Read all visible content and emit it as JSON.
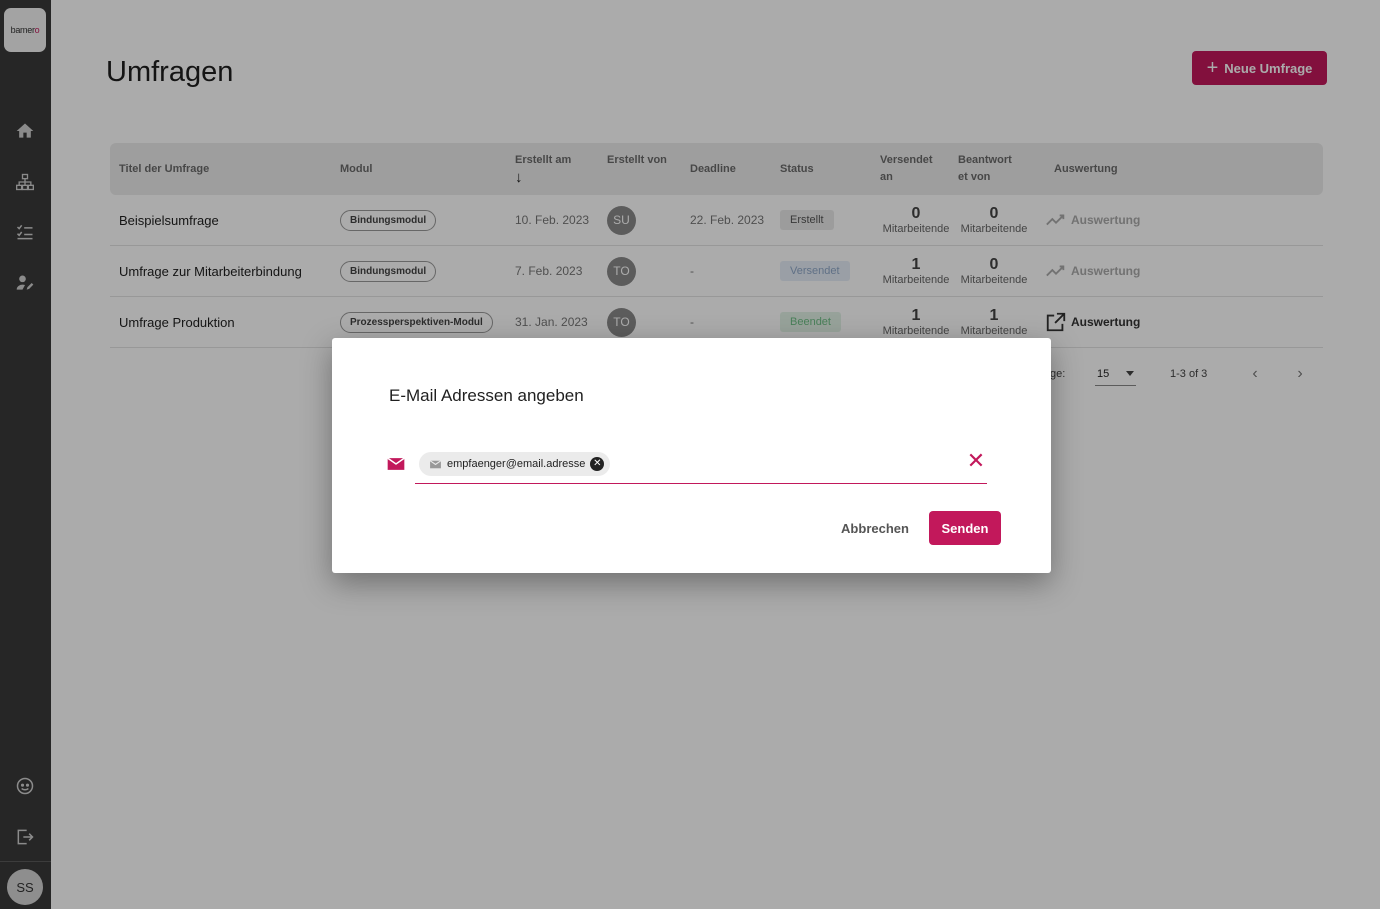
{
  "app": {
    "logo_text": "bamer",
    "logo_accent": "o",
    "user_initials": "SS"
  },
  "sidebar": {
    "icons": [
      "home-icon",
      "org-chart-icon",
      "checklist-icon",
      "user-edit-icon",
      "support-icon",
      "logout-icon"
    ]
  },
  "page": {
    "title": "Umfragen",
    "new_button": "Neue Umfrage",
    "new_button_icon": "+"
  },
  "table": {
    "headers": {
      "title": "Titel der Umfrage",
      "module": "Modul",
      "created_at": "Erstellt am",
      "created_by": "Erstellt von",
      "deadline": "Deadline",
      "status": "Status",
      "sent_to_1": "Versendet",
      "sent_to_2": "an",
      "answered_1": "Beantwort",
      "answered_2": "et von",
      "evaluation": "Auswertung"
    },
    "rows": [
      {
        "title": "Beispielsumfrage",
        "module": "Bindungsmodul",
        "created_at": "10. Feb. 2023",
        "created_by": "SU",
        "deadline": "22. Feb. 2023",
        "status": "Erstellt",
        "sent": "0",
        "sent_unit": "Mitarbeitende",
        "answered": "0",
        "answered_unit": "Mitarbeitende",
        "evaluation": "Auswertung"
      },
      {
        "title": "Umfrage zur Mitarbeiterbindung",
        "module": "Bindungsmodul",
        "created_at": "7. Feb. 2023",
        "created_by": "TO",
        "deadline": "-",
        "status": "Versendet",
        "sent": "1",
        "sent_unit": "Mitarbeitende",
        "answered": "0",
        "answered_unit": "Mitarbeitende",
        "evaluation": "Auswertung"
      },
      {
        "title": "Umfrage Produktion",
        "module": "Prozessperspektiven-Modul",
        "created_at": "31. Jan. 2023",
        "created_by": "TO",
        "deadline": "-",
        "status": "Beendet",
        "sent": "1",
        "sent_unit": "Mitarbeitende",
        "answered": "1",
        "answered_unit": "Mitarbeitende",
        "evaluation": "Auswertung"
      }
    ]
  },
  "pagination": {
    "rows_label": "ge:",
    "rows_per_page": "15",
    "range": "1-3 of 3"
  },
  "dialog": {
    "title": "E-Mail Adressen angeben",
    "email_chip": "empfaenger@email.adresse",
    "cancel": "Abbrechen",
    "send": "Senden"
  },
  "colors": {
    "accent": "#c2185b",
    "sidebar": "#3a3a3a"
  }
}
